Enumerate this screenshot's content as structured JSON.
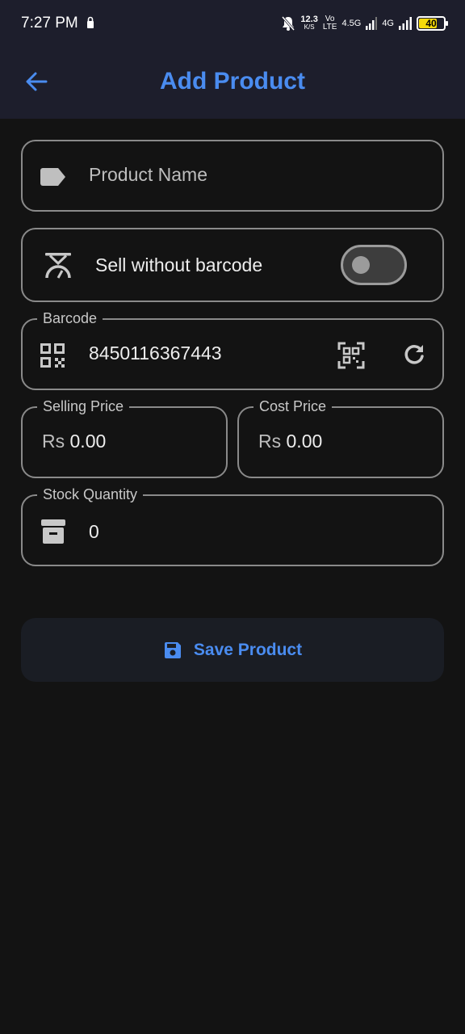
{
  "status_bar": {
    "time": "7:27 PM",
    "net_speed_value": "12.3",
    "net_speed_unit": "K/S",
    "volte_top": "Vo",
    "volte_bottom": "LTE",
    "net1": "4.5G",
    "net2": "4G",
    "battery": "40"
  },
  "app_bar": {
    "title": "Add Product",
    "back_icon": "arrow-left-icon"
  },
  "form": {
    "product_name": {
      "placeholder": "Product Name",
      "icon": "tag-icon"
    },
    "sell_without_barcode": {
      "label": "Sell without barcode",
      "icon": "scale-icon",
      "enabled": false
    },
    "barcode": {
      "label": "Barcode",
      "value": "8450116367443",
      "icon": "qr-code-icon",
      "scan_icon": "qr-scan-icon",
      "refresh_icon": "refresh-icon"
    },
    "selling_price": {
      "label": "Selling Price",
      "prefix": "Rs",
      "value": "0.00"
    },
    "cost_price": {
      "label": "Cost Price",
      "prefix": "Rs",
      "value": "0.00"
    },
    "stock_quantity": {
      "label": "Stock Quantity",
      "value": "0",
      "icon": "archive-icon"
    }
  },
  "save_button": {
    "label": "Save Product",
    "icon": "save-icon"
  },
  "colors": {
    "accent": "#4a8cf0",
    "background": "#131313",
    "app_bar": "#1d1e2c"
  }
}
